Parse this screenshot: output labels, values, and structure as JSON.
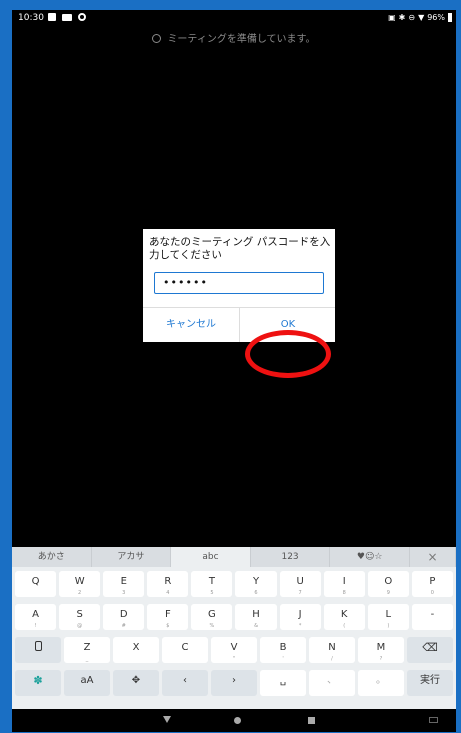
{
  "status_bar": {
    "time": "10:30",
    "battery": "96%"
  },
  "preparing_text": "ミーティングを準備しています。",
  "dialog": {
    "title": "あなたのミーティング パスコードを入力してください",
    "passcode_value": "••••••",
    "cancel_label": "キャンセル",
    "ok_label": "OK"
  },
  "keyboard": {
    "tabs": [
      "あかさ",
      "アカサ",
      "abc",
      "123",
      "♥☺☆"
    ],
    "close_label": "×",
    "row1": [
      {
        "main": "Q",
        "sub": ""
      },
      {
        "main": "W",
        "sub": "2"
      },
      {
        "main": "E",
        "sub": "3"
      },
      {
        "main": "R",
        "sub": "4"
      },
      {
        "main": "T",
        "sub": "5"
      },
      {
        "main": "Y",
        "sub": "6"
      },
      {
        "main": "U",
        "sub": "7"
      },
      {
        "main": "I",
        "sub": "8"
      },
      {
        "main": "O",
        "sub": "9"
      },
      {
        "main": "P",
        "sub": "0"
      }
    ],
    "row2": [
      {
        "main": "A",
        "sub": "!"
      },
      {
        "main": "S",
        "sub": "@"
      },
      {
        "main": "D",
        "sub": "#"
      },
      {
        "main": "F",
        "sub": "$"
      },
      {
        "main": "G",
        "sub": "%"
      },
      {
        "main": "H",
        "sub": "&"
      },
      {
        "main": "J",
        "sub": "*"
      },
      {
        "main": "K",
        "sub": "("
      },
      {
        "main": "L",
        "sub": ")"
      },
      {
        "main": "-",
        "sub": ""
      }
    ],
    "row3": [
      {
        "main": "Z",
        "sub": "_"
      },
      {
        "main": "X",
        "sub": ""
      },
      {
        "main": "C",
        "sub": ""
      },
      {
        "main": "V",
        "sub": "\""
      },
      {
        "main": "B",
        "sub": "'"
      },
      {
        "main": "N",
        "sub": "/"
      },
      {
        "main": "M",
        "sub": "?"
      }
    ],
    "row4": {
      "case_label": "aA",
      "enter_label": "実行"
    }
  },
  "colors": {
    "frame": "#1a6fc4",
    "accent": "#1e78d2",
    "highlight_ring": "#e11111"
  }
}
